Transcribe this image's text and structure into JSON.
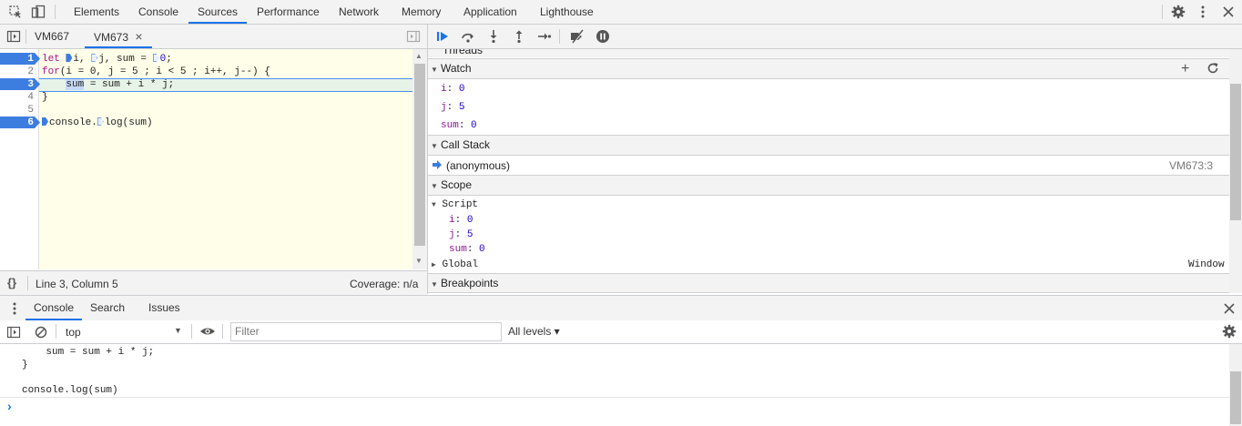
{
  "top_tabs": [
    {
      "label": "Elements"
    },
    {
      "label": "Console"
    },
    {
      "label": "Sources",
      "active": true
    },
    {
      "label": "Performance"
    },
    {
      "label": "Network"
    },
    {
      "label": "Memory"
    },
    {
      "label": "Application"
    },
    {
      "label": "Lighthouse"
    }
  ],
  "file_tabs": {
    "tab1": "VM667",
    "tab2": "VM673",
    "close": "×"
  },
  "editor": {
    "line_numbers": [
      "1",
      "2",
      "3",
      "4",
      "5",
      "6"
    ],
    "line1": {
      "let": "let ",
      "i": "i, ",
      "j": "j, sum = ",
      "zero": "0",
      "end": ";"
    },
    "line2": {
      "for": "for",
      "rest": "(i = 0, j = 5 ; i < 5 ; i++, j--) {"
    },
    "line3": {
      "indent": "    ",
      "sum": "sum",
      "rest": " = sum + i * j;"
    },
    "line4": "}",
    "line5": "",
    "line6": {
      "a": "console.",
      "b": "log(sum)"
    }
  },
  "statusbar": {
    "braces": "{}",
    "position": "Line 3, Column 5",
    "coverage": "Coverage: n/a"
  },
  "sections": {
    "threads": "Threads",
    "watch": "Watch",
    "call_stack": "Call Stack",
    "scope": "Scope",
    "breakpoints": "Breakpoints"
  },
  "watch": [
    {
      "name": "i",
      "value": "0"
    },
    {
      "name": "j",
      "value": "5"
    },
    {
      "name": "sum",
      "value": "0"
    }
  ],
  "call_stack": [
    {
      "name": "(anonymous)",
      "location": "VM673:3"
    }
  ],
  "scope": {
    "script_label": "Script",
    "vars": [
      {
        "name": "i",
        "value": "0"
      },
      {
        "name": "j",
        "value": "5"
      },
      {
        "name": "sum",
        "value": "0"
      }
    ],
    "global_label": "Global",
    "global_value": "Window"
  },
  "drawer_tabs": [
    {
      "label": "Console",
      "active": true
    },
    {
      "label": "Search"
    },
    {
      "label": "Issues"
    }
  ],
  "console_toolbar": {
    "context": "top",
    "filter_placeholder": "Filter",
    "levels": "All levels ▾"
  },
  "console_output": [
    "    sum = sum + i * j;",
    "}",
    "",
    "console.log(sum)"
  ],
  "prompt": "›",
  "colors": {
    "accent": "#1a73e8",
    "breakpoint": "#3c7de0",
    "editor_bg": "#ffffe9",
    "keyword": "#aa0d91",
    "number": "#1c00cf"
  }
}
